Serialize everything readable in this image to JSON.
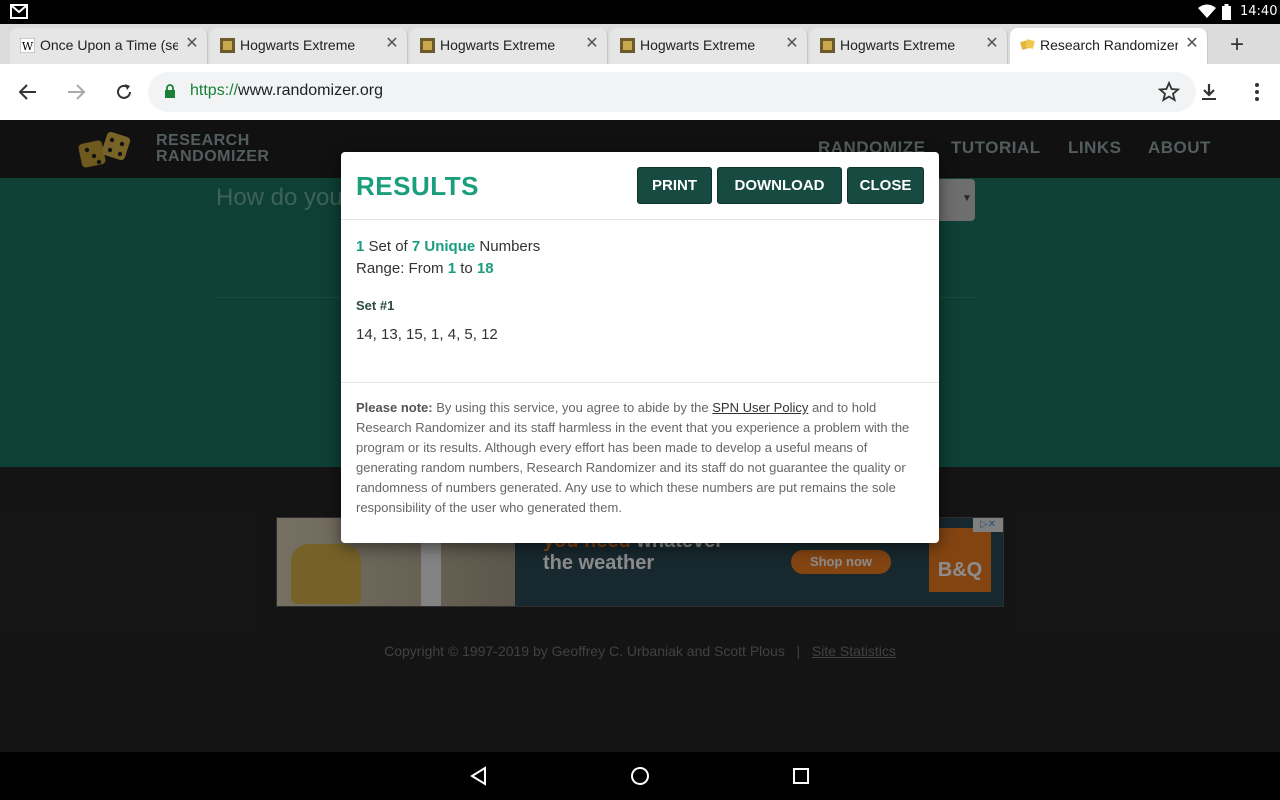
{
  "status_bar": {
    "time": "14:40"
  },
  "tabs": [
    {
      "title": "Once Upon a Time (se",
      "active": false
    },
    {
      "title": "Hogwarts Extreme",
      "active": false
    },
    {
      "title": "Hogwarts Extreme",
      "active": false
    },
    {
      "title": "Hogwarts Extreme",
      "active": false
    },
    {
      "title": "Hogwarts Extreme",
      "active": false
    },
    {
      "title": "Research Randomizer",
      "active": true
    }
  ],
  "omnibox": {
    "scheme": "https://",
    "host": "www.randomizer.org"
  },
  "site": {
    "logo_line1": "RESEARCH",
    "logo_line2": "RANDOMIZER",
    "nav": [
      "RANDOMIZE",
      "TUTORIAL",
      "LINKS",
      "ABOUT"
    ],
    "question": "How do you"
  },
  "modal": {
    "title": "RESULTS",
    "buttons": {
      "print": "PRINT",
      "download": "DOWNLOAD",
      "close": "CLOSE"
    },
    "summary": {
      "set_count": "1",
      "set_of": " Set of ",
      "number_count": "7",
      "unique": "Unique",
      "numbers": " Numbers",
      "range_prefix": "Range: From ",
      "range_from": "1",
      "range_to_word": " to ",
      "range_to": "18"
    },
    "set_label": "Set #1",
    "set_values": "14, 13, 15, 1, 4, 5, 12",
    "note": {
      "label": "Please note:",
      "text_before_link": " By using this service, you agree to abide by the ",
      "link": "SPN User Policy",
      "text_after_link": " and to hold Research Randomizer and its staff harmless in the event that you experience a problem with the program or its results. Although every effort has been made to develop a useful means of generating random numbers, Research Randomizer and its staff do not guarantee the quality or randomness of numbers generated. Any use to which these numbers are put remains the sole responsibility of the user who generated them."
    }
  },
  "ad": {
    "headline_orange": "you need",
    "headline_white1": " whatever",
    "headline_white2": "the weather",
    "cta": "Shop now",
    "brand": "B&Q"
  },
  "footer": {
    "copyright": "Copyright © 1997-2019 by Geoffrey C. Urbaniak and Scott Plous",
    "separator": "|",
    "link": "Site Statistics"
  },
  "colors": {
    "accent": "#1a9e7e",
    "button": "#174a40",
    "hero": "#1a7561"
  }
}
